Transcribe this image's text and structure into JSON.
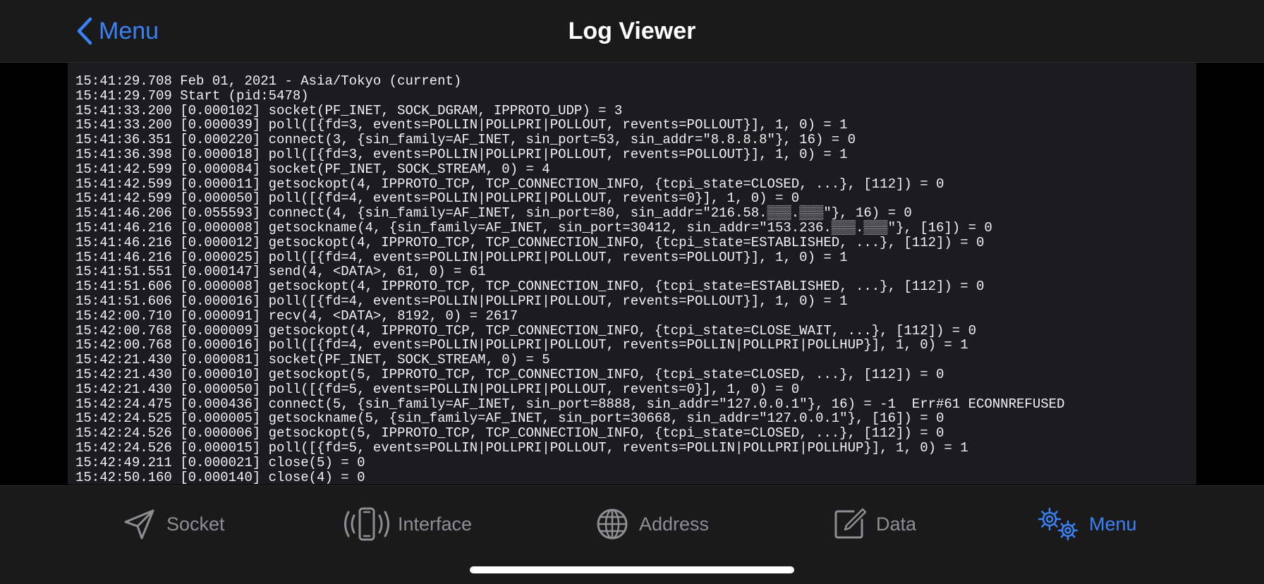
{
  "navbar": {
    "back_label": "Menu",
    "title": "Log Viewer"
  },
  "log": {
    "lines": [
      "15:41:29.708 Feb 01, 2021 - Asia/Tokyo (current)",
      "15:41:29.709 Start (pid:5478)",
      "15:41:33.200 [0.000102] socket(PF_INET, SOCK_DGRAM, IPPROTO_UDP) = 3",
      "15:41:33.200 [0.000039] poll([{fd=3, events=POLLIN|POLLPRI|POLLOUT, revents=POLLOUT}], 1, 0) = 1",
      "15:41:36.351 [0.000220] connect(3, {sin_family=AF_INET, sin_port=53, sin_addr=\"8.8.8.8\"}, 16) = 0",
      "15:41:36.398 [0.000018] poll([{fd=3, events=POLLIN|POLLPRI|POLLOUT, revents=POLLOUT}], 1, 0) = 1",
      "15:41:42.599 [0.000084] socket(PF_INET, SOCK_STREAM, 0) = 4",
      "15:41:42.599 [0.000011] getsockopt(4, IPPROTO_TCP, TCP_CONNECTION_INFO, {tcpi_state=CLOSED, ...}, [112]) = 0",
      "15:41:42.599 [0.000050] poll([{fd=4, events=POLLIN|POLLPRI|POLLOUT, revents=0}], 1, 0) = 0",
      "15:41:46.206 [0.055593] connect(4, {sin_family=AF_INET, sin_port=80, sin_addr=\"216.58.▒▒▒.▒▒▒\"}, 16) = 0",
      "15:41:46.216 [0.000008] getsockname(4, {sin_family=AF_INET, sin_port=30412, sin_addr=\"153.236.▒▒▒.▒▒▒\"}, [16]) = 0",
      "15:41:46.216 [0.000012] getsockopt(4, IPPROTO_TCP, TCP_CONNECTION_INFO, {tcpi_state=ESTABLISHED, ...}, [112]) = 0",
      "15:41:46.216 [0.000025] poll([{fd=4, events=POLLIN|POLLPRI|POLLOUT, revents=POLLOUT}], 1, 0) = 1",
      "15:41:51.551 [0.000147] send(4, <DATA>, 61, 0) = 61",
      "15:41:51.606 [0.000008] getsockopt(4, IPPROTO_TCP, TCP_CONNECTION_INFO, {tcpi_state=ESTABLISHED, ...}, [112]) = 0",
      "15:41:51.606 [0.000016] poll([{fd=4, events=POLLIN|POLLPRI|POLLOUT, revents=POLLOUT}], 1, 0) = 1",
      "15:42:00.710 [0.000091] recv(4, <DATA>, 8192, 0) = 2617",
      "15:42:00.768 [0.000009] getsockopt(4, IPPROTO_TCP, TCP_CONNECTION_INFO, {tcpi_state=CLOSE_WAIT, ...}, [112]) = 0",
      "15:42:00.768 [0.000016] poll([{fd=4, events=POLLIN|POLLPRI|POLLOUT, revents=POLLIN|POLLPRI|POLLHUP}], 1, 0) = 1",
      "15:42:21.430 [0.000081] socket(PF_INET, SOCK_STREAM, 0) = 5",
      "15:42:21.430 [0.000010] getsockopt(5, IPPROTO_TCP, TCP_CONNECTION_INFO, {tcpi_state=CLOSED, ...}, [112]) = 0",
      "15:42:21.430 [0.000050] poll([{fd=5, events=POLLIN|POLLPRI|POLLOUT, revents=0}], 1, 0) = 0",
      "15:42:24.475 [0.000436] connect(5, {sin_family=AF_INET, sin_port=8888, sin_addr=\"127.0.0.1\"}, 16) = -1  Err#61 ECONNREFUSED",
      "15:42:24.525 [0.000005] getsockname(5, {sin_family=AF_INET, sin_port=30668, sin_addr=\"127.0.0.1\"}, [16]) = 0",
      "15:42:24.526 [0.000006] getsockopt(5, IPPROTO_TCP, TCP_CONNECTION_INFO, {tcpi_state=CLOSED, ...}, [112]) = 0",
      "15:42:24.526 [0.000015] poll([{fd=5, events=POLLIN|POLLPRI|POLLOUT, revents=POLLIN|POLLPRI|POLLHUP}], 1, 0) = 1",
      "15:42:49.211 [0.000021] close(5) = 0",
      "15:42:50.160 [0.000140] close(4) = 0"
    ]
  },
  "tabs": [
    {
      "label": "Socket",
      "icon": "paper-plane-icon",
      "active": false
    },
    {
      "label": "Interface",
      "icon": "phone-signal-icon",
      "active": false
    },
    {
      "label": "Address",
      "icon": "globe-icon",
      "active": false
    },
    {
      "label": "Data",
      "icon": "edit-icon",
      "active": false
    },
    {
      "label": "Menu",
      "icon": "gears-icon",
      "active": true
    }
  ],
  "colors": {
    "accent": "#3a82f7",
    "inactive": "#8e8e93",
    "bar_background": "#1a1a1a",
    "log_background": "#1c1c1e",
    "log_text": "#f2f2f2"
  }
}
